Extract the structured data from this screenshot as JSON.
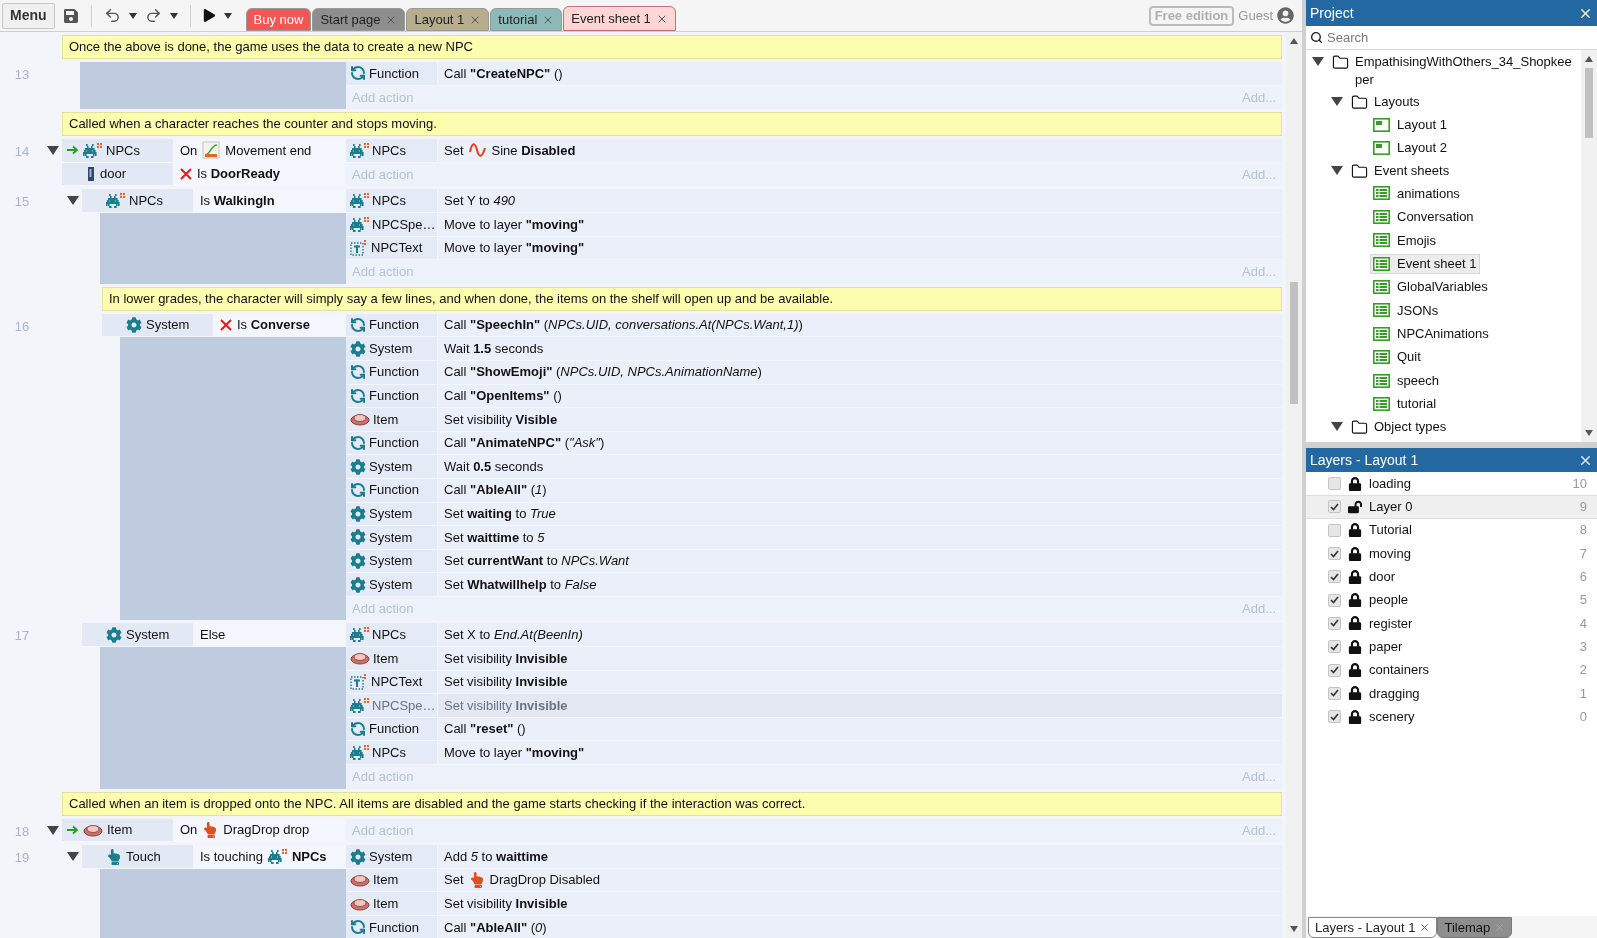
{
  "toolbar": {
    "menu": "Menu",
    "edition": "Free edition",
    "user": "Guest"
  },
  "tabs": [
    {
      "label": "Buy now",
      "kind": "promo",
      "color": "#f25656",
      "selected": false
    },
    {
      "label": "Start page",
      "kind": "page",
      "color": "#8e8e8e",
      "selected": false
    },
    {
      "label": "Layout 1",
      "kind": "page",
      "color": "#b6ad8c",
      "selected": false
    },
    {
      "label": "tutorial",
      "kind": "page",
      "color": "#8dbab8",
      "selected": false
    },
    {
      "label": "Event sheet 1",
      "kind": "page",
      "color": "#ffd6d6",
      "selected": true
    }
  ],
  "event_sheet": {
    "events": [
      {
        "kind": "comment",
        "text": "Once the above is done, the game uses the data to create a new NPC"
      },
      {
        "kind": "event",
        "number": "13",
        "actions": [
          {
            "object": "Function",
            "kind": "function",
            "text": "Call **\"CreateNPC\"** ()",
            "disabled": false
          }
        ],
        "add_action": "Add action",
        "add_more": "Add..."
      },
      {
        "kind": "comment",
        "text": "Called when a character reaches the counter and stops moving."
      },
      {
        "kind": "event",
        "number": "14",
        "expanded": true,
        "conditions": [
          {
            "object": "NPCs",
            "kind": "sprite",
            "trigger": true,
            "inverted": false,
            "text_before": "On",
            "inline_icon": {
              "kind": "tween"
            },
            "text": "Movement end"
          },
          {
            "object": "door",
            "kind": "door",
            "trigger": false,
            "inverted": true,
            "text": "Is **DoorReady**"
          }
        ],
        "actions": [
          {
            "object": "NPCs",
            "kind": "sprite",
            "text_before": "Set",
            "inline_icon": {
              "kind": "sine"
            },
            "text": "Sine **Disabled**",
            "disabled": false
          }
        ],
        "add_action": "Add action",
        "add_more": "Add...",
        "children": [
          {
            "kind": "event",
            "number": "15",
            "expanded": true,
            "conditions": [
              {
                "object": "NPCs",
                "kind": "sprite",
                "trigger": false,
                "inverted": false,
                "text": "Is **WalkingIn**"
              }
            ],
            "actions": [
              {
                "object": "NPCs",
                "kind": "sprite",
                "text": "Set Y to *490*",
                "disabled": false
              },
              {
                "object": "NPCSpe…",
                "kind": "sprite",
                "text": "Move to layer **\"moving\"**",
                "disabled": false
              },
              {
                "object": "NPCText",
                "kind": "text",
                "text": "Move to layer **\"moving\"**",
                "disabled": false
              }
            ],
            "add_action": "Add action",
            "add_more": "Add...",
            "children": [
              {
                "kind": "comment",
                "text": "In lower grades, the character will simply say a few lines, and when done, the items on the shelf will open up and be available."
              },
              {
                "kind": "event",
                "number": "16",
                "conditions": [
                  {
                    "object": "System",
                    "kind": "system",
                    "trigger": false,
                    "inverted": true,
                    "text": "Is **Converse**"
                  }
                ],
                "actions": [
                  {
                    "object": "Function",
                    "kind": "function",
                    "text": "Call **\"SpeechIn\"** (*NPCs.UID, conversations.At(NPCs.Want,1)*)",
                    "disabled": false
                  },
                  {
                    "object": "System",
                    "kind": "system",
                    "text": "Wait **1.5** seconds",
                    "disabled": false
                  },
                  {
                    "object": "Function",
                    "kind": "function",
                    "text": "Call **\"ShowEmoji\"** (*NPCs.UID, NPCs.AnimationName*)",
                    "disabled": false
                  },
                  {
                    "object": "Function",
                    "kind": "function",
                    "text": "Call **\"OpenItems\"** ()",
                    "disabled": false
                  },
                  {
                    "object": "Item",
                    "kind": "item",
                    "text": "Set visibility **Visible**",
                    "disabled": false
                  },
                  {
                    "object": "Function",
                    "kind": "function",
                    "text": "Call **\"AnimateNPC\"** (*\"Ask\"*)",
                    "disabled": false
                  },
                  {
                    "object": "System",
                    "kind": "system",
                    "text": "Wait **0.5** seconds",
                    "disabled": false
                  },
                  {
                    "object": "Function",
                    "kind": "function",
                    "text": "Call **\"AbleAll\"** (*1*)",
                    "disabled": false
                  },
                  {
                    "object": "System",
                    "kind": "system",
                    "text": "Set **waiting** to *True*",
                    "disabled": false
                  },
                  {
                    "object": "System",
                    "kind": "system",
                    "text": "Set **waittime** to *5*",
                    "disabled": false
                  },
                  {
                    "object": "System",
                    "kind": "system",
                    "text": "Set **currentWant** to *NPCs.Want*",
                    "disabled": false
                  },
                  {
                    "object": "System",
                    "kind": "system",
                    "text": "Set **Whatwillhelp** to *False*",
                    "disabled": false
                  }
                ],
                "add_action": "Add action",
                "add_more": "Add..."
              }
            ]
          },
          {
            "kind": "event",
            "number": "17",
            "conditions": [
              {
                "object": "System",
                "kind": "system",
                "trigger": false,
                "inverted": false,
                "text": "Else"
              }
            ],
            "actions": [
              {
                "object": "NPCs",
                "kind": "sprite",
                "text": "Set X to *End.At(BeenIn)*",
                "disabled": false
              },
              {
                "object": "Item",
                "kind": "item",
                "text": "Set visibility **Invisible**",
                "disabled": false
              },
              {
                "object": "NPCText",
                "kind": "text",
                "text": "Set visibility **Invisible**",
                "disabled": false
              },
              {
                "object": "NPCSpe…",
                "kind": "sprite",
                "text": "Set visibility **Invisible**",
                "disabled": true
              },
              {
                "object": "Function",
                "kind": "function",
                "text": "Call **\"reset\"** ()",
                "disabled": false
              },
              {
                "object": "NPCs",
                "kind": "sprite",
                "text": "Move to layer **\"moving\"**",
                "disabled": false
              }
            ],
            "add_action": "Add action",
            "add_more": "Add..."
          }
        ]
      },
      {
        "kind": "comment",
        "text": "Called when an item is dropped onto the NPC. All items are disabled and the game starts checking if the interaction was correct."
      },
      {
        "kind": "event",
        "number": "18",
        "expanded": true,
        "conditions": [
          {
            "object": "Item",
            "kind": "item",
            "trigger": true,
            "inverted": false,
            "text_before": "On",
            "inline_icon": {
              "kind": "dragdrop"
            },
            "text": "DragDrop drop"
          }
        ],
        "add_action": "Add action",
        "add_more": "Add...",
        "children": [
          {
            "kind": "event",
            "number": "19",
            "expanded": true,
            "conditions": [
              {
                "object": "Touch",
                "kind": "touch",
                "trigger": false,
                "inverted": false,
                "text_before": "Is touching",
                "inline_icon": {
                  "kind": "sprite"
                },
                "text": "**NPCs**"
              }
            ],
            "actions": [
              {
                "object": "System",
                "kind": "system",
                "text": "Add *5* to **waittime**",
                "disabled": false
              },
              {
                "object": "Item",
                "kind": "item",
                "text_before": "Set",
                "inline_icon": {
                  "kind": "dragdrop"
                },
                "text": "DragDrop Disabled",
                "disabled": false
              },
              {
                "object": "Item",
                "kind": "item",
                "text": "Set visibility **Invisible**",
                "disabled": false
              },
              {
                "object": "Function",
                "kind": "function",
                "text": "Call **\"AbleAll\"** (*0*)",
                "disabled": false
              }
            ]
          }
        ]
      }
    ]
  },
  "project": {
    "title": "Project",
    "search_placeholder": "Search",
    "tree": [
      {
        "label": "EmpathisingWithOthers_34_Shopkeeper",
        "kind": "folder",
        "expanded": true,
        "children": [
          {
            "label": "Layouts",
            "kind": "folder",
            "expanded": true,
            "children": [
              {
                "label": "Layout 1",
                "kind": "layout",
                "selected": false
              },
              {
                "label": "Layout 2",
                "kind": "layout",
                "selected": false
              }
            ]
          },
          {
            "label": "Event sheets",
            "kind": "folder",
            "expanded": true,
            "children": [
              {
                "label": "animations",
                "kind": "sheet",
                "selected": false
              },
              {
                "label": "Conversation",
                "kind": "sheet",
                "selected": false
              },
              {
                "label": "Emojis",
                "kind": "sheet",
                "selected": false
              },
              {
                "label": "Event sheet 1",
                "kind": "sheet",
                "selected": true
              },
              {
                "label": "GlobalVariables",
                "kind": "sheet",
                "selected": false
              },
              {
                "label": "JSONs",
                "kind": "sheet",
                "selected": false
              },
              {
                "label": "NPCAnimations",
                "kind": "sheet",
                "selected": false
              },
              {
                "label": "Quit",
                "kind": "sheet",
                "selected": false
              },
              {
                "label": "speech",
                "kind": "sheet",
                "selected": false
              },
              {
                "label": "tutorial",
                "kind": "sheet",
                "selected": false
              }
            ]
          },
          {
            "label": "Object types",
            "kind": "folder",
            "expanded": true
          }
        ]
      }
    ]
  },
  "layers": {
    "title": "Layers - Layout 1",
    "rows": [
      {
        "name": "loading",
        "number": "10",
        "visible": false,
        "locked": true,
        "selected": false
      },
      {
        "name": "Layer 0",
        "number": "9",
        "visible": true,
        "locked": false,
        "selected": true
      },
      {
        "name": "Tutorial",
        "number": "8",
        "visible": false,
        "locked": true,
        "selected": false
      },
      {
        "name": "moving",
        "number": "7",
        "visible": true,
        "locked": true,
        "selected": false
      },
      {
        "name": "door",
        "number": "6",
        "visible": true,
        "locked": true,
        "selected": false
      },
      {
        "name": "people",
        "number": "5",
        "visible": true,
        "locked": true,
        "selected": false
      },
      {
        "name": "register",
        "number": "4",
        "visible": true,
        "locked": true,
        "selected": false
      },
      {
        "name": "paper",
        "number": "3",
        "visible": true,
        "locked": true,
        "selected": false
      },
      {
        "name": "containers",
        "number": "2",
        "visible": true,
        "locked": true,
        "selected": false
      },
      {
        "name": "dragging",
        "number": "1",
        "visible": true,
        "locked": true,
        "selected": false
      },
      {
        "name": "scenery",
        "number": "0",
        "visible": true,
        "locked": true,
        "selected": false
      }
    ]
  },
  "panel_tabs": [
    {
      "label": "Layers - Layout 1",
      "selected": true
    },
    {
      "label": "Tilemap",
      "selected": false
    }
  ]
}
